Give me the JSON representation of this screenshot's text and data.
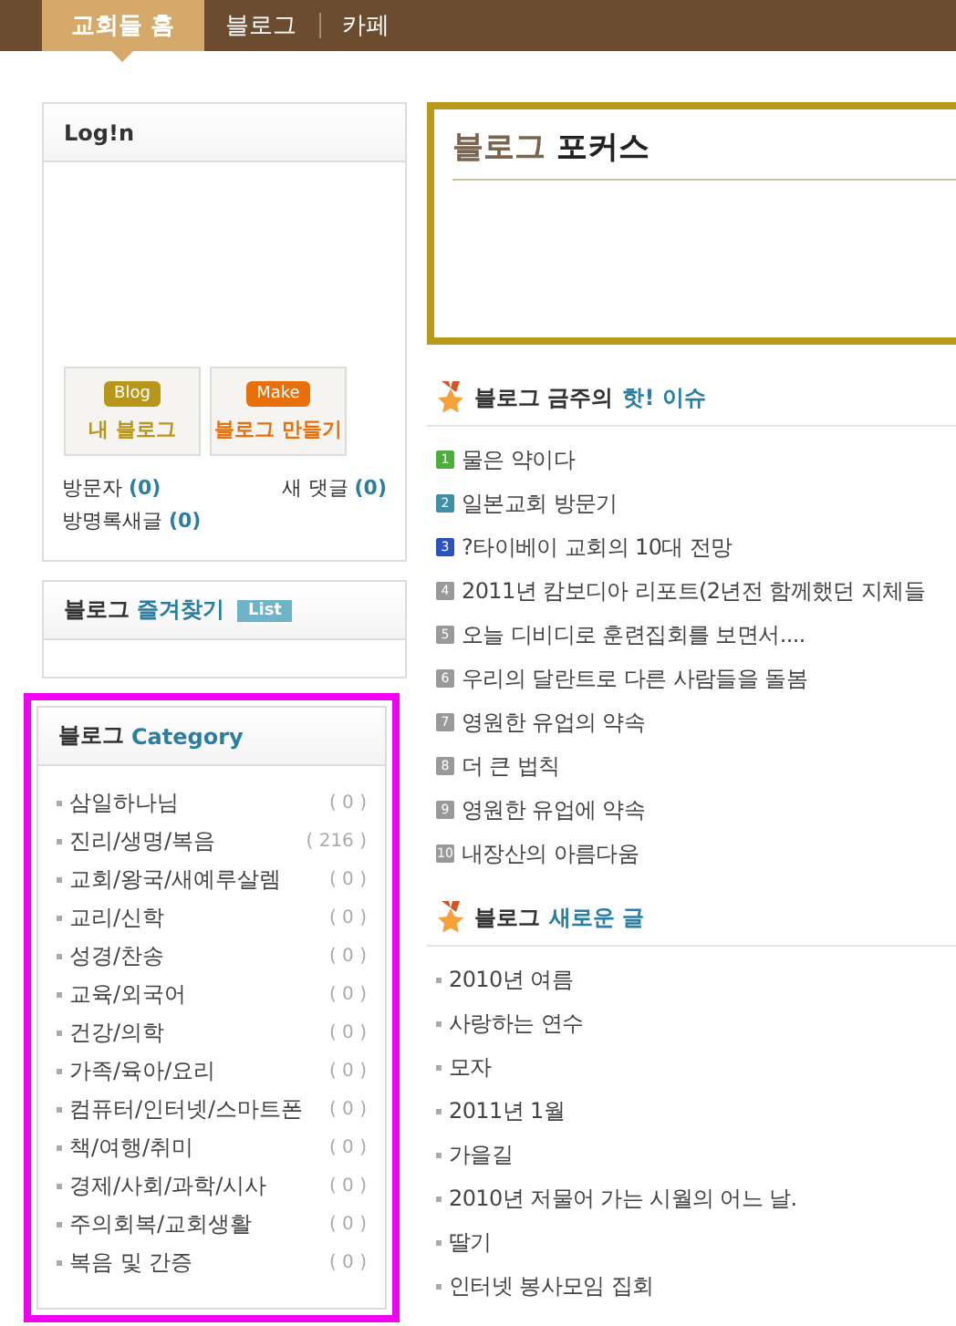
{
  "nav": {
    "tabs": [
      {
        "label": "교회들 홈",
        "selected": true
      },
      {
        "label": "블로그",
        "selected": false
      },
      {
        "label": "카페",
        "selected": false
      }
    ]
  },
  "login": {
    "title": "Log!n",
    "buttons": [
      {
        "kind": "blog",
        "badge": "Blog",
        "label": "내 블로그"
      },
      {
        "kind": "make",
        "badge": "Make",
        "label": "블로그 만들기"
      }
    ],
    "stats": [
      {
        "label": "방문자",
        "count": "(0)"
      },
      {
        "label": "새 댓글",
        "count": "(0)"
      },
      {
        "label": "방명록새글",
        "count": "(0)"
      }
    ]
  },
  "favorites": {
    "title": "블로그",
    "accent": "즐겨찾기",
    "badge": "List"
  },
  "category": {
    "title": "블로그",
    "accent": "Category",
    "items": [
      {
        "name": "삼일하나님",
        "count": "( 0 )"
      },
      {
        "name": "진리/생명/복음",
        "count": "( 216 )"
      },
      {
        "name": "교회/왕국/새예루살렘",
        "count": "( 0 )"
      },
      {
        "name": "교리/신학",
        "count": "( 0 )"
      },
      {
        "name": "성경/찬송",
        "count": "( 0 )"
      },
      {
        "name": "교육/외국어",
        "count": "( 0 )"
      },
      {
        "name": "건강/의학",
        "count": "( 0 )"
      },
      {
        "name": "가족/육아/요리",
        "count": "( 0 )"
      },
      {
        "name": "컴퓨터/인터넷/스마트폰",
        "count": "( 0 )"
      },
      {
        "name": "책/여행/취미",
        "count": "( 0 )"
      },
      {
        "name": "경제/사회/과학/시사",
        "count": "( 0 )"
      },
      {
        "name": "주의회복/교회생활",
        "count": "( 0 )"
      },
      {
        "name": "복음 및 간증",
        "count": "( 0 )"
      }
    ]
  },
  "focus": {
    "title": "블로그",
    "accent": "포커스"
  },
  "hot": {
    "title": "블로그 금주의",
    "accent": "핫! 이슈",
    "items": [
      {
        "number": "1",
        "title": "물은 약이다",
        "color": "#4caf3a"
      },
      {
        "number": "2",
        "title": "일본교회 방문기",
        "color": "#3f8fa8"
      },
      {
        "number": "3",
        "title": "?타이베이 교회의 10대 전망",
        "color": "#2a55c0"
      },
      {
        "number": "4",
        "title": "2011년 캄보디아 리포트(2년전 함께했던 지체들",
        "color": "#9a9a9a"
      },
      {
        "number": "5",
        "title": "오늘 디비디로 훈련집회를 보면서....",
        "color": "#9a9a9a"
      },
      {
        "number": "6",
        "title": "우리의 달란트로 다른 사람들을 돌봄",
        "color": "#9a9a9a"
      },
      {
        "number": "7",
        "title": "영원한 유업의 약속",
        "color": "#9a9a9a"
      },
      {
        "number": "8",
        "title": "더 큰 법칙",
        "color": "#9a9a9a"
      },
      {
        "number": "9",
        "title": "영원한 유업에 약속",
        "color": "#9a9a9a"
      },
      {
        "number": "10",
        "title": "내장산의 아름다움",
        "color": "#9a9a9a"
      }
    ]
  },
  "new_posts": {
    "title": "블로그",
    "accent": "새로운 글",
    "items": [
      "2010년 여름",
      "사랑하는 연수",
      "모자",
      "2011년 1월",
      "가을길",
      "2010년 저물어 가는 시월의 어느 날.",
      "딸기",
      "인터넷 봉사모임 집회"
    ]
  }
}
